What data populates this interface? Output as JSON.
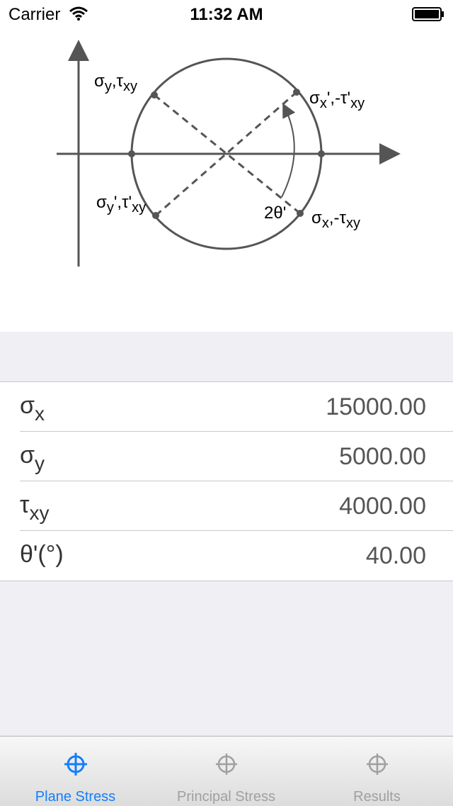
{
  "status_bar": {
    "carrier": "Carrier",
    "time": "11:32 AM"
  },
  "diagram": {
    "point_top_left": {
      "base": "σ",
      "sub1": "y",
      "sep": ",τ",
      "sub2": "xy"
    },
    "point_bottom_left": {
      "base": "σ",
      "sub1": "y",
      "sep": "',τ'",
      "sub2": "xy"
    },
    "point_top_right": {
      "base": "σ",
      "sub1": "x",
      "sep": "',-τ'",
      "sub2": "xy"
    },
    "point_bottom_right": {
      "base": "σ",
      "sub1": "x",
      "sep": ",-τ",
      "sub2": "xy"
    },
    "angle_label": "2θ'"
  },
  "inputs": [
    {
      "base": "σ",
      "sub": "x",
      "value": "15000.00"
    },
    {
      "base": "σ",
      "sub": "y",
      "value": "5000.00"
    },
    {
      "base": "τ",
      "sub": "xy",
      "value": "4000.00"
    },
    {
      "base": "θ'(°)",
      "sub": "",
      "value": "40.00"
    }
  ],
  "tabs": [
    {
      "label": "Plane Stress",
      "icon": "crosshair-icon",
      "active": true
    },
    {
      "label": "Principal Stress",
      "icon": "crosshair-icon",
      "active": false
    },
    {
      "label": "Results",
      "icon": "crosshair-icon",
      "active": false
    }
  ],
  "colors": {
    "accent": "#147efb",
    "inactive": "#a0a0a0",
    "diagram": "#555555"
  }
}
